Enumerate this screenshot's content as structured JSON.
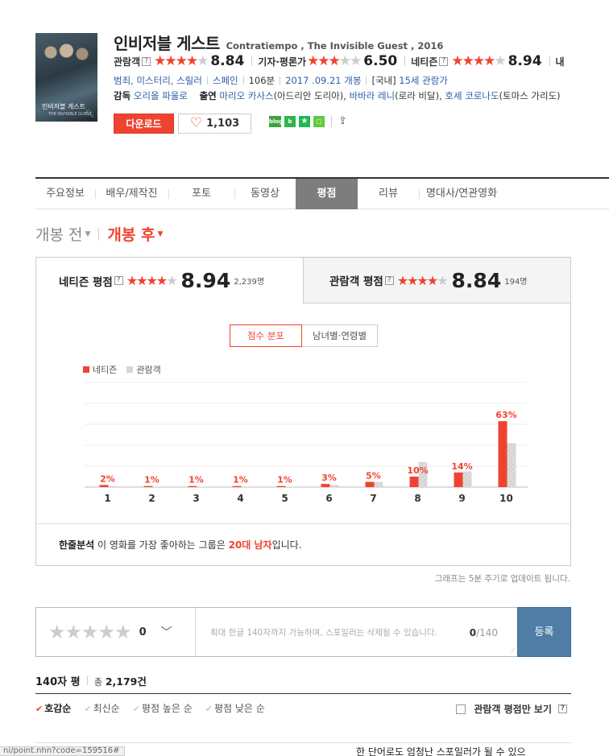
{
  "colors": {
    "accent": "#f0432f",
    "audience_bar": "#d6d6d6",
    "submit": "#4f7da6",
    "link": "#2c5fa6"
  },
  "poster": {
    "title": "인비저블 게스트",
    "subtitle": "THE INVISIBLE GUEST",
    "icon": "magnifier-icon"
  },
  "movie": {
    "title_ko": "인비저블 게스트",
    "title_en": "Contratiempo , The Invisible Guest , 2016",
    "ratings": [
      {
        "label": "관람객",
        "score": "8.84",
        "fraction": 0.884
      },
      {
        "label": "기자·평론가",
        "score": "6.50",
        "fraction": 0.65
      },
      {
        "label": "네티즌",
        "score": "8.94",
        "fraction": 0.894
      },
      {
        "label": "내"
      }
    ],
    "genres": "범죄, 미스터리, 스릴러",
    "country": "스페인",
    "runtime": "106분",
    "release": "2017 .09.21 개봉",
    "rating_prefix": "[국내]",
    "rating_grade": "15세 관람가",
    "director_label": "감독",
    "director": "오리올 파울로",
    "cast_label": "출연",
    "cast": [
      {
        "name": "마리오 카사스",
        "role": "(아드리안 도리아),"
      },
      {
        "name": "바바라 레니",
        "role": "(로라 비달),"
      },
      {
        "name": "호세 코로나도",
        "role": "(토마스 가리도)"
      }
    ],
    "download_label": "다운로드",
    "like_count": "1,103"
  },
  "share": {
    "blog": "blog",
    "icons": [
      "blog-icon",
      "band-icon",
      "star-icon",
      "square-icon",
      "share-icon"
    ]
  },
  "tabs": [
    "주요정보",
    "배우/제작진",
    "포토",
    "동영상",
    "평점",
    "리뷰",
    "명대사/연관영화"
  ],
  "active_tab": 4,
  "period": {
    "before": "개봉 전",
    "after": "개봉 후"
  },
  "panel": {
    "netizen": {
      "label": "네티즌 평점",
      "score": "8.94",
      "fraction": 0.894,
      "count": "2,239명"
    },
    "audience": {
      "label": "관람객 평점",
      "score": "8.84",
      "fraction": 0.884,
      "count": "194명"
    },
    "seg_on": "점수 분포",
    "seg_off": "남녀별·연령별",
    "summary_label": "한줄분석",
    "summary_text1": " 이 영화를 가장 좋아하는 그룹은 ",
    "summary_highlight": "20대 남자",
    "summary_text2": "입니다."
  },
  "chart_data": {
    "type": "bar",
    "categories": [
      "1",
      "2",
      "3",
      "4",
      "5",
      "6",
      "7",
      "8",
      "9",
      "10"
    ],
    "series": [
      {
        "name": "네티즌",
        "values": [
          2,
          1,
          1,
          1,
          1,
          3,
          5,
          10,
          14,
          63
        ]
      },
      {
        "name": "관람객",
        "values": [
          1,
          0.5,
          0.5,
          0.5,
          0.5,
          2,
          5,
          24,
          15,
          42
        ]
      }
    ],
    "data_labels": [
      "2%",
      "1%",
      "1%",
      "1%",
      "1%",
      "3%",
      "5%",
      "10%",
      "14%",
      "63%"
    ],
    "ylim": [
      0,
      100
    ],
    "grid": true,
    "legend": "top-left"
  },
  "update_note": "그래프는 5분 주기로 업데이트 됩니다.",
  "review": {
    "star_count": "0",
    "placeholder": "최대 한글 140자까지 가능하며, 스포일러는 삭제될 수 있습니다.",
    "count_current": "0",
    "count_max": "/140",
    "submit_label": "등록"
  },
  "reviews": {
    "heading": "140자 평",
    "total_prefix": "총",
    "total": "2,179건",
    "sorts": [
      "호감순",
      "최신순",
      "평점 높은 순",
      "평점 낮은 순"
    ],
    "active_sort": 0,
    "only_audience": "관람객 평점만 보기"
  },
  "status_url": "ni/point.nhn?code=159516#",
  "spoiler_notice": "한 단어로도 엄청난 스포일러가 될 수 있으"
}
